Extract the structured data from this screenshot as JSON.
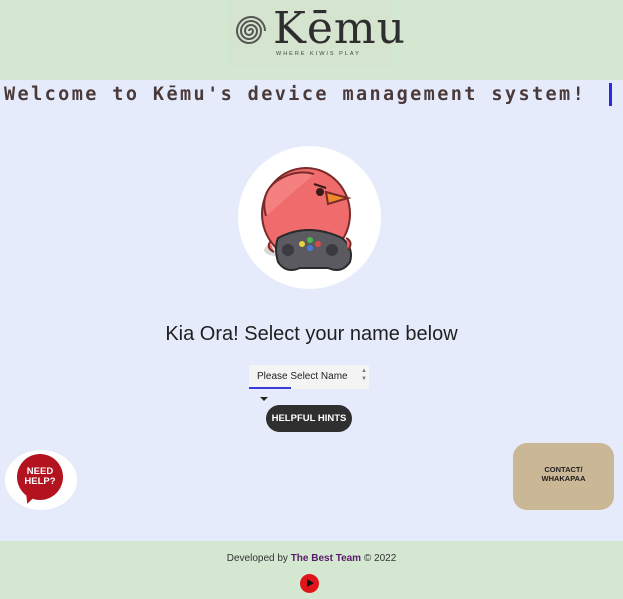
{
  "logo": {
    "wordmark": "Kēmu",
    "tagline": "WHERE KIWIS PLAY"
  },
  "welcome": {
    "text": "Welcome to Kēmu's device management system!"
  },
  "main": {
    "greeting": "Kia Ora! Select your name below",
    "select_placeholder": "Please Select Name",
    "hints_label": "HELPFUL HINTS"
  },
  "need_help": {
    "line1": "NEED",
    "line2": "HELP?"
  },
  "contact": {
    "line1": "CONTACT/",
    "line2": "WHAKAPAA"
  },
  "footer": {
    "prefix": "Developed by ",
    "team": "The Best Team",
    "suffix": " © 2022"
  },
  "colors": {
    "header_bg": "#d4e7d1",
    "page_bg": "#e6ebfb",
    "hints_bg": "#2f2f2f",
    "contact_bg": "#c9b795",
    "need_help_red": "#b3121f",
    "play_red": "#e0151c",
    "team_purple": "#5a1a6a"
  },
  "icons": {
    "logo_mark": "spiral-icon",
    "mascot": "kiwi-bird-gamer-icon",
    "dropdown": "caret-down-icon",
    "play": "play-icon"
  }
}
